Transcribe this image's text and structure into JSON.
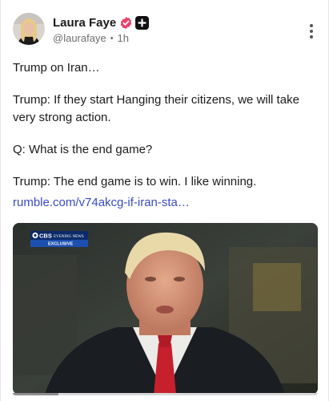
{
  "author": {
    "display_name": "Laura Faye",
    "handle": "@laurafaye",
    "separator": "•",
    "time": "1h",
    "verified_color": "#e8436e"
  },
  "post": {
    "lines": [
      "Trump on Iran…",
      "Trump: If they start Hanging their citizens, we will take very strong action.",
      "Q: What is the end game?",
      "Trump: The end game is to win. I like winning."
    ],
    "link_text": "rumble.com/v74akcg-if-iran-sta…"
  },
  "media": {
    "logo_line1": "CBS EVENING NEWS",
    "logo_line2": "EXCLUSIVE",
    "progress": 0.15
  },
  "colors": {
    "link": "#3a4cc4",
    "text": "#1a1a1a",
    "muted": "#6e6e6e"
  },
  "icons": {
    "verified": "check-badge-icon",
    "plus": "plus-badge-icon",
    "more": "more-vertical-icon"
  }
}
